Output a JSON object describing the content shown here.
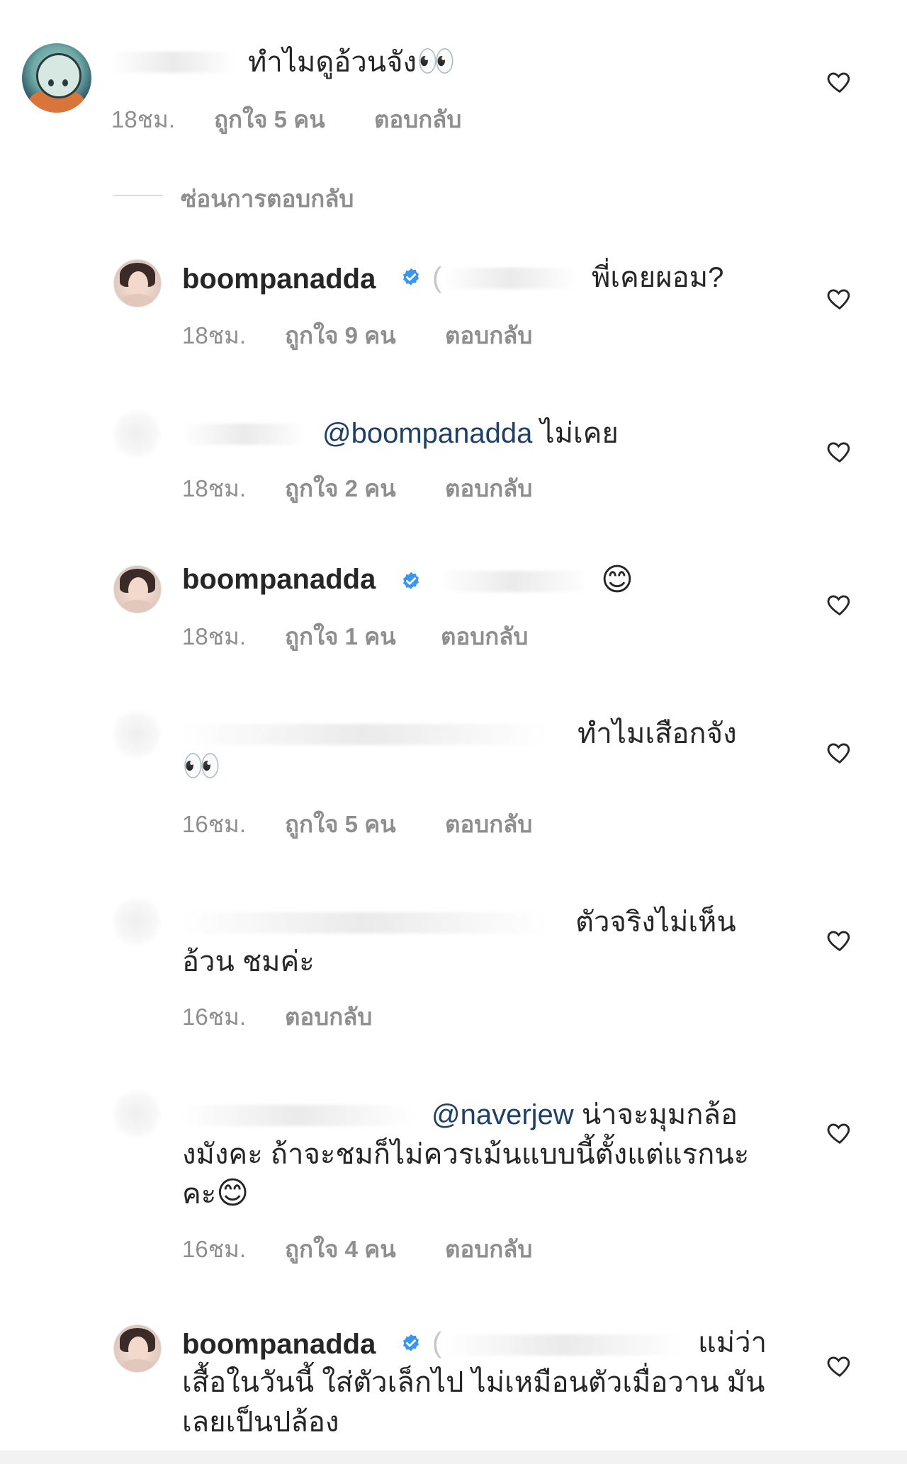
{
  "comments": [
    {
      "text": "ทำไมดูอ้วนจัง",
      "eyes_emoji": "👀",
      "time": "18ชม.",
      "likes": "ถูกใจ 5 คน",
      "reply": "ตอบกลับ"
    }
  ],
  "hide_replies": "ซ่อนการตอบกลับ",
  "replies": [
    {
      "username": "boompanadda",
      "paren": "(",
      "text": "พี่เคยผอม?",
      "time": "18ชม.",
      "likes": "ถูกใจ 9 คน",
      "reply": "ตอบกลับ"
    },
    {
      "mention": "@boompanadda",
      "text": "ไม่เคย",
      "time": "18ชม.",
      "likes": "ถูกใจ 2 คน",
      "reply": "ตอบกลับ"
    },
    {
      "username": "boompanadda",
      "emoji": "😊",
      "time": "18ชม.",
      "likes": "ถูกใจ 1 คน",
      "reply": "ตอบกลับ"
    },
    {
      "text": "ทำไมเสือกจัง",
      "eyes_emoji": "👀",
      "time": "16ชม.",
      "likes": "ถูกใจ 5 คน",
      "reply": "ตอบกลับ"
    },
    {
      "text_line1": "ตัวจริงไม่เห็น",
      "text_line2": "อ้วน ชมค่ะ",
      "time": "16ชม.",
      "reply": "ตอบกลับ"
    },
    {
      "mention": "@naverjew",
      "text_line1": "น่าจะมุมกล้อ",
      "text_line2": "งมังคะ ถ้าจะชมก็ไม่ควรเม้นแบบนี้ตั้งแต่แรกนะ",
      "text_line3": "คะ",
      "emoji": "😊",
      "time": "16ชม.",
      "likes": "ถูกใจ 4 คน",
      "reply": "ตอบกลับ"
    },
    {
      "username": "boompanadda",
      "paren": "(",
      "text_line1": "แม่ว่า",
      "text_line2": "เสื้อในวันนี้ ใส่ตัวเล็กไป ไม่เหมือนตัวเมื่อวาน มัน",
      "text_line3": "เลยเป็นปล้อง"
    }
  ],
  "icons": {
    "heart": "heart-icon",
    "verified": "verified-badge-icon"
  },
  "colors": {
    "verified": "#3897f0",
    "meta": "#8e8e8e",
    "mention": "#1e3f66",
    "text": "#262626"
  }
}
